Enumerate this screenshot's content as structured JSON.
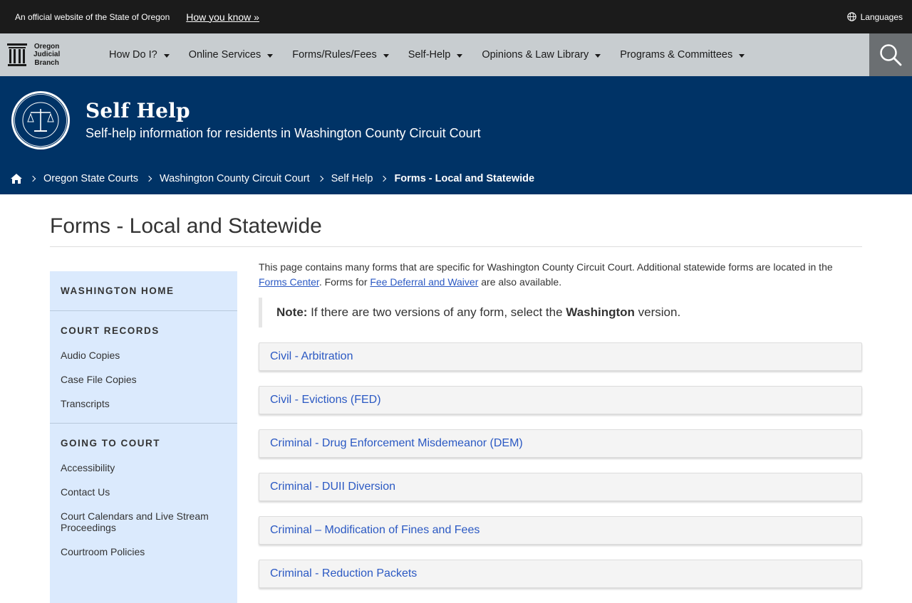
{
  "topbar": {
    "official_text": "An official website of the State of Oregon",
    "how_you_know": "How you know »",
    "languages": "Languages"
  },
  "brand": {
    "line1": "Oregon",
    "line2": "Judicial",
    "line3": "Branch"
  },
  "nav": {
    "items": [
      {
        "label": "How Do I?"
      },
      {
        "label": "Online Services"
      },
      {
        "label": "Forms/Rules/Fees"
      },
      {
        "label": "Self-Help"
      },
      {
        "label": "Opinions & Law Library"
      },
      {
        "label": "Programs & Committees"
      }
    ]
  },
  "hero": {
    "title": "Self Help",
    "subtitle": "Self-help information for residents in Washington County Circuit Court"
  },
  "breadcrumb": {
    "items": [
      "Oregon State Courts",
      "Washington County Circuit Court",
      "Self Help"
    ],
    "current": "Forms - Local and Statewide"
  },
  "page": {
    "title": "Forms - Local and Statewide"
  },
  "sidebar": {
    "home": "WASHINGTON HOME",
    "court_records": {
      "heading": "COURT RECORDS",
      "links": [
        "Audio Copies",
        "Case File Copies",
        "Transcripts"
      ]
    },
    "going_to_court": {
      "heading": "GOING TO COURT",
      "links": [
        "Accessibility",
        "Contact Us",
        "Court Calendars and Live Stream Proceedings",
        "Courtroom Policies"
      ]
    }
  },
  "intro": {
    "text1": "This page contains many forms that are specific for Washington County Circuit Court. Additional statewide forms are located in the ",
    "link1": "Forms Center",
    "text2": ". Forms for ",
    "link2": "Fee Deferral and Waiver",
    "text3": " are also available."
  },
  "note": {
    "label": "Note:",
    "text_before": " If there are two versions of any form, select the ",
    "bold_word": "Washington",
    "text_after": " version."
  },
  "accordion": [
    "Civil - Arbitration",
    "Civil - Evictions (FED)",
    "Criminal - Drug Enforcement Misdemeanor (DEM)",
    "Criminal - DUII Diversion",
    "Criminal – Modification of Fines and Fees",
    "Criminal - Reduction Packets"
  ],
  "colors": {
    "topbar": "#1b1b1b",
    "navbar": "#c8cdd0",
    "hero": "#003366",
    "sidebar": "#dbeafd",
    "link": "#2b59c3"
  }
}
